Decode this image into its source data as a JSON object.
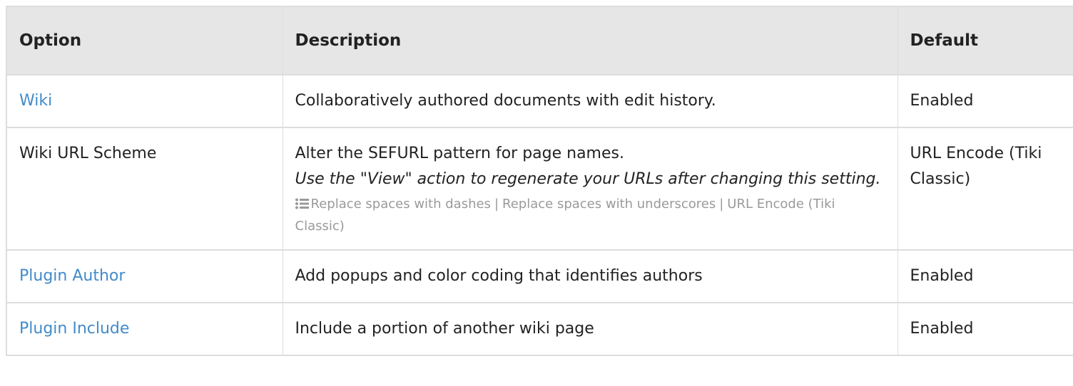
{
  "table": {
    "headers": {
      "option": "Option",
      "description": "Description",
      "default": "Default"
    },
    "rows": [
      {
        "option": "Wiki",
        "option_is_link": true,
        "description": "Collaboratively authored documents with edit history.",
        "default": "Enabled"
      },
      {
        "option": "Wiki URL Scheme",
        "option_is_link": false,
        "description": "Alter the SEFURL pattern for page names.",
        "hint": "Use the \"View\" action to regenerate your URLs after changing this setting.",
        "options_icon": "list-icon",
        "options": [
          "Replace spaces with dashes",
          "Replace spaces with underscores",
          "URL Encode (Tiki Classic)"
        ],
        "options_separator": "|",
        "default": "URL Encode (Tiki Classic)"
      },
      {
        "option": "Plugin Author",
        "option_is_link": true,
        "description": "Add popups and color coding that identifies authors",
        "default": "Enabled"
      },
      {
        "option": "Plugin Include",
        "option_is_link": true,
        "description": "Include a portion of another wiki page",
        "default": "Enabled"
      }
    ]
  },
  "colors": {
    "link": "#428bca",
    "header_bg": "#e6e6e6",
    "border": "#dddddd",
    "muted_text": "#9a9a9a",
    "text": "#222222"
  }
}
